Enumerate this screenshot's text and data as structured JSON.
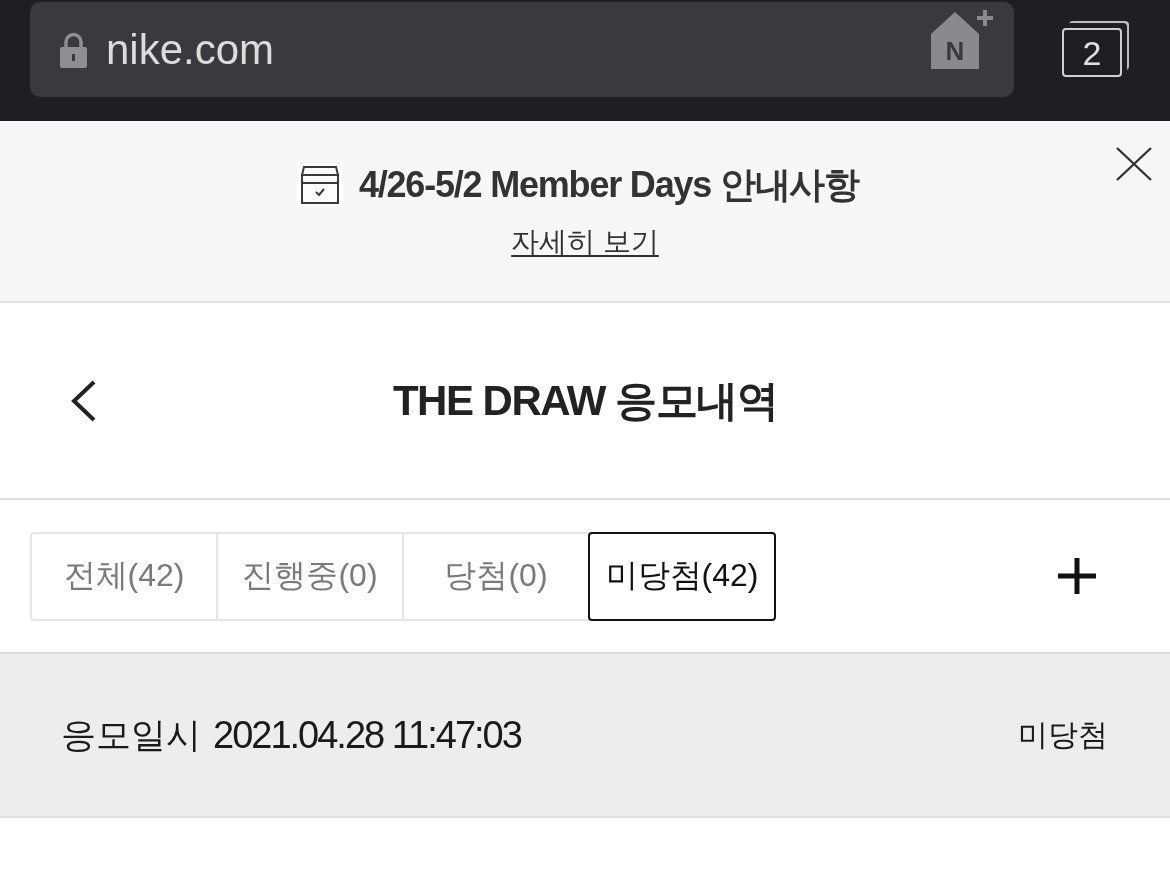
{
  "browser": {
    "url": "nike.com",
    "home_badge_letter": "N",
    "tab_count": "2"
  },
  "banner": {
    "title": "4/26-5/2 Member Days 안내사항",
    "link": "자세히 보기"
  },
  "header": {
    "title": "THE DRAW 응모내역"
  },
  "filter_tabs": [
    {
      "label": "전체(42)",
      "selected": false
    },
    {
      "label": "진행중(0)",
      "selected": false
    },
    {
      "label": "당첨(0)",
      "selected": false
    },
    {
      "label": "미당첨(42)",
      "selected": true
    }
  ],
  "entries": [
    {
      "label": "응모일시",
      "datetime": "2021.04.28 11:47:03",
      "status": "미당첨"
    }
  ]
}
